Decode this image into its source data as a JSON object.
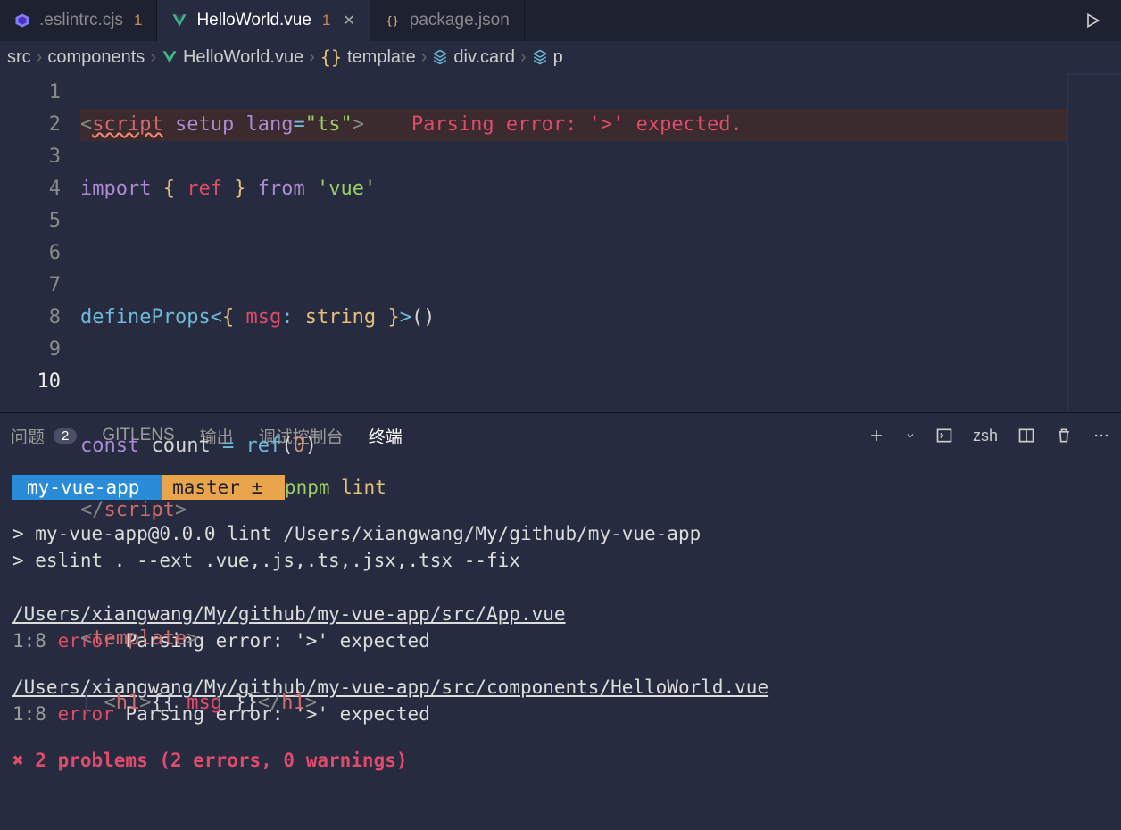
{
  "tabs": [
    {
      "icon": "eslint-icon",
      "label": ".eslintrc.cjs",
      "dirty": "1",
      "active": false
    },
    {
      "icon": "vue-icon",
      "label": "HelloWorld.vue",
      "dirty": "1",
      "active": true
    },
    {
      "icon": "json-icon",
      "label": "package.json",
      "dirty": "",
      "active": false
    }
  ],
  "breadcrumb": {
    "src": "src",
    "components": "components",
    "file": "HelloWorld.vue",
    "template": "template",
    "div": "div.card",
    "p": "p"
  },
  "editor": {
    "line_numbers": [
      "1",
      "2",
      "3",
      "4",
      "5",
      "6",
      "7",
      "8",
      "9",
      "10"
    ],
    "inline_error": "Parsing error: '>' expected.",
    "tokens": {
      "l1_script": "script",
      "l1_setup": "setup",
      "l1_lang": "lang",
      "l1_eq": "=",
      "l1_ts": "\"ts\"",
      "l2_import": "import",
      "l2_ref": "ref",
      "l2_from": "from",
      "l2_vue": "'vue'",
      "l4_define": "defineProps",
      "l4_msg": "msg",
      "l4_string": "string",
      "l6_const": "const",
      "l6_count": "count",
      "l6_ref": "ref",
      "l6_zero": "0",
      "l7_script": "script",
      "l9_template": "template",
      "l10_h1": "h1",
      "l10_msg": "msg"
    }
  },
  "panel": {
    "problems_label": "问题",
    "problems_count": "2",
    "gitlens": "GITLENS",
    "output": "输出",
    "debug": "调试控制台",
    "terminal": "终端",
    "shell": "zsh"
  },
  "terminal": {
    "prompt_project": "my-vue-app",
    "prompt_branch_icon": "",
    "prompt_branch": "master",
    "prompt_dirty": "±",
    "cmd_a": "pnpm",
    "cmd_b": "lint",
    "run_line1": "> my-vue-app@0.0.0 lint /Users/xiangwang/My/github/my-vue-app",
    "run_line2": "> eslint . --ext .vue,.js,.ts,.jsx,.tsx --fix",
    "file1": "/Users/xiangwang/My/github/my-vue-app/src/App.vue",
    "loc1": "1:8",
    "err1_tag": "error",
    "err1_msg": "Parsing error: '>' expected",
    "file2": "/Users/xiangwang/My/github/my-vue-app/src/components/HelloWorld.vue",
    "loc2": "1:8",
    "err2_tag": "error",
    "err2_msg": "Parsing error: '>' expected",
    "summary": "✖ 2 problems (2 errors, 0 warnings)"
  }
}
